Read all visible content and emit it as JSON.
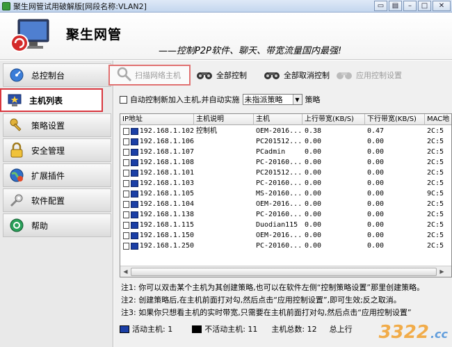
{
  "window": {
    "title": "聚生网管试用破解版[网段名称:VLAN2]"
  },
  "header": {
    "brand": "聚生网管",
    "slogan": "——控制P2P软件、聊天、带宽流量国内最强!"
  },
  "sidebar": {
    "items": [
      {
        "label": "总控制台",
        "icon": "dashboard-icon"
      },
      {
        "label": "主机列表",
        "icon": "host-list-icon"
      },
      {
        "label": "策略设置",
        "icon": "policy-key-icon"
      },
      {
        "label": "安全管理",
        "icon": "lock-icon"
      },
      {
        "label": "扩展插件",
        "icon": "plugin-globe-icon"
      },
      {
        "label": "软件配置",
        "icon": "config-wrench-icon"
      },
      {
        "label": "帮助",
        "icon": "help-icon"
      }
    ]
  },
  "toolbar": {
    "scan": "扫描网络主机",
    "control_all": "全部控制",
    "uncontrol_all": "全部取消控制",
    "apply": "应用控制设置"
  },
  "options": {
    "auto_control_label": "自动控制新加入主机,并自动实施",
    "policy_select_value": "未指派策略",
    "policy_suffix": "策略"
  },
  "table": {
    "columns": [
      "IP地址",
      "主机说明",
      "主机",
      "上行带宽(KB/S)",
      "下行带宽(KB/S)",
      "MAC地"
    ],
    "rows": [
      {
        "ip": "192.168.1.102",
        "desc": "控制机",
        "host": "OEM-2016...",
        "up": "0.38",
        "down": "0.47",
        "mac": "2C:5"
      },
      {
        "ip": "192.168.1.106",
        "desc": "",
        "host": "PC201512...",
        "up": "0.00",
        "down": "0.00",
        "mac": "2C:5"
      },
      {
        "ip": "192.168.1.107",
        "desc": "",
        "host": "PCadmin",
        "up": "0.00",
        "down": "0.00",
        "mac": "2C:5"
      },
      {
        "ip": "192.168.1.108",
        "desc": "",
        "host": "PC-20160...",
        "up": "0.00",
        "down": "0.00",
        "mac": "2C:5"
      },
      {
        "ip": "192.168.1.101",
        "desc": "",
        "host": "PC201512...",
        "up": "0.00",
        "down": "0.00",
        "mac": "2C:5"
      },
      {
        "ip": "192.168.1.103",
        "desc": "",
        "host": "PC-20160...",
        "up": "0.00",
        "down": "0.00",
        "mac": "2C:5"
      },
      {
        "ip": "192.168.1.105",
        "desc": "",
        "host": "MS-20160...",
        "up": "0.00",
        "down": "0.00",
        "mac": "9C:5"
      },
      {
        "ip": "192.168.1.104",
        "desc": "",
        "host": "OEM-2016...",
        "up": "0.00",
        "down": "0.00",
        "mac": "2C:5"
      },
      {
        "ip": "192.168.1.138",
        "desc": "",
        "host": "PC-20160...",
        "up": "0.00",
        "down": "0.00",
        "mac": "2C:5"
      },
      {
        "ip": "192.168.1.115",
        "desc": "",
        "host": "Duodian115",
        "up": "0.00",
        "down": "0.00",
        "mac": "2C:5"
      },
      {
        "ip": "192.168.1.150",
        "desc": "",
        "host": "OEM-2016...",
        "up": "0.00",
        "down": "0.00",
        "mac": "2C:5"
      },
      {
        "ip": "192.168.1.250",
        "desc": "",
        "host": "PC-20160...",
        "up": "0.00",
        "down": "0.00",
        "mac": "2C:5"
      }
    ]
  },
  "notes": [
    "注1: 你可以双击某个主机为其创建策略,也可以在软件左侧“控制策略设置”那里创建策略。",
    "注2: 创建策略后,在主机前面打对勾,然后点击“应用控制设置”,即可生效;反之取消。",
    "注3: 如果你只想看主机的实时带宽,只需要在主机前面打对勾,然后点击“应用控制设置”"
  ],
  "status": {
    "active_label": "活动主机: 1",
    "inactive_label": "不活动主机: 11",
    "total_label": "主机总数: 12",
    "upload_label": "总上行"
  },
  "watermark": {
    "text": "3322",
    "suffix": ".cc"
  },
  "colors": {
    "highlight_red": "#d9363e",
    "monitor_blue": "#1b3fa6",
    "watermark_orange": "#f2a12e"
  }
}
